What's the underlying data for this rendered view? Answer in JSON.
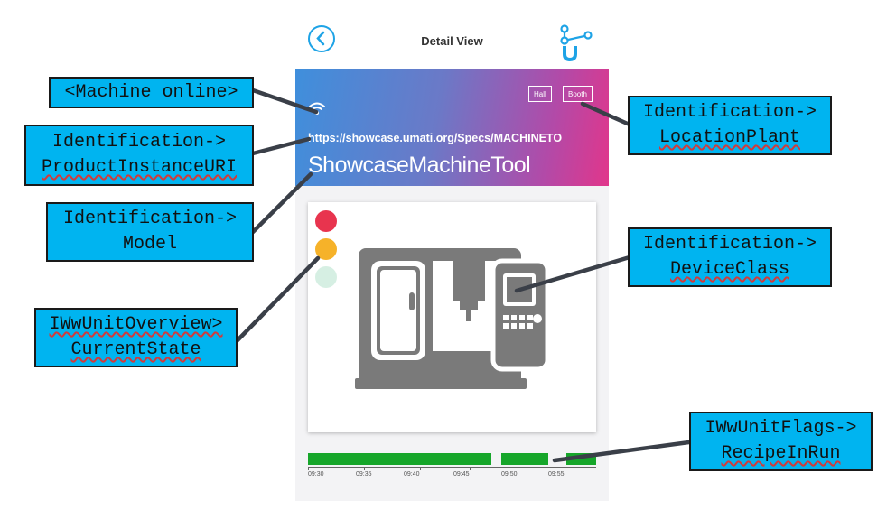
{
  "header": {
    "title": "Detail View",
    "back_icon": "chevron-left-icon",
    "logo_icon": "umati-logo-icon"
  },
  "banner": {
    "hall_label": "Hall",
    "booth_label": "Booth",
    "uri": "https://showcase.umati.org/Specs/MACHINETO",
    "model": "ShowcaseMachineTool"
  },
  "state_lights": {
    "red": "#e8344e",
    "amber": "#f6b229",
    "green": "#d6efe3"
  },
  "timeline": {
    "labels": [
      "09:30",
      "09:35",
      "09:40",
      "09:45",
      "09:50",
      "09:55"
    ],
    "bar_color": "#16a62a"
  },
  "callouts": {
    "machine_online": "<Machine online>",
    "product_uri_1": "Identification->",
    "product_uri_2": "ProductInstanceURI",
    "model_1": "Identification->",
    "model_2": "Model",
    "state_1": "IWwUnitOverview>",
    "state_2": "CurrentState",
    "location_1": "Identification->",
    "location_2": "LocationPlant",
    "device_1": "Identification->",
    "device_2": "DeviceClass",
    "recipe_1": "IWwUnitFlags->",
    "recipe_2": "RecipeInRun"
  }
}
